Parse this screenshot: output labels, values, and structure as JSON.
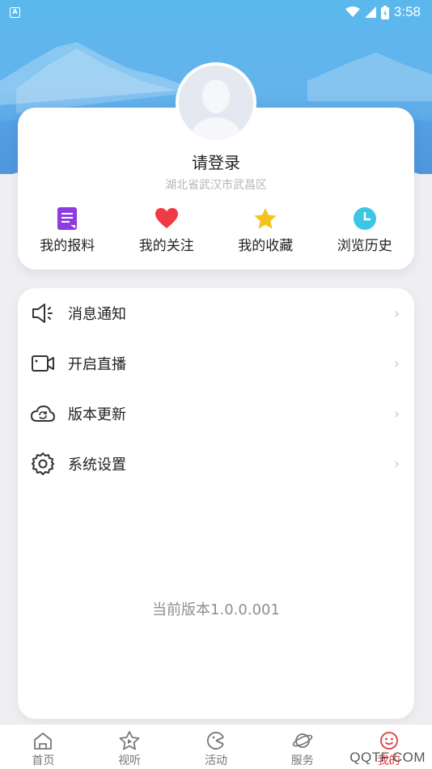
{
  "status_bar": {
    "left_badge": "A",
    "time": "3:58"
  },
  "profile": {
    "login_prompt": "请登录",
    "location": "湖北省武汉市武昌区",
    "quick_links": [
      {
        "label": "我的报料",
        "icon": "document-icon",
        "color": "#8e3ce0"
      },
      {
        "label": "我的关注",
        "icon": "heart-icon",
        "color": "#ee3b45"
      },
      {
        "label": "我的收藏",
        "icon": "star-icon",
        "color": "#f4c21c"
      },
      {
        "label": "浏览历史",
        "icon": "clock-icon",
        "color": "#3cc6e4"
      }
    ]
  },
  "menu": {
    "items": [
      {
        "label": "消息通知",
        "icon": "speaker-icon"
      },
      {
        "label": "开启直播",
        "icon": "video-camera-icon"
      },
      {
        "label": "版本更新",
        "icon": "cloud-refresh-icon"
      },
      {
        "label": "系统设置",
        "icon": "gear-icon"
      }
    ],
    "version": "当前版本1.0.0.001"
  },
  "tabs": [
    {
      "label": "首页",
      "icon": "home-icon",
      "active": false
    },
    {
      "label": "视听",
      "icon": "play-star-icon",
      "active": false
    },
    {
      "label": "活动",
      "icon": "activity-icon",
      "active": false
    },
    {
      "label": "服务",
      "icon": "planet-icon",
      "active": false
    },
    {
      "label": "我的",
      "icon": "smiley-icon",
      "active": true
    }
  ],
  "watermark": "QQTF.COM",
  "colors": {
    "header_blue": "#5ab8ec",
    "active_tab": "#e03a3a"
  }
}
